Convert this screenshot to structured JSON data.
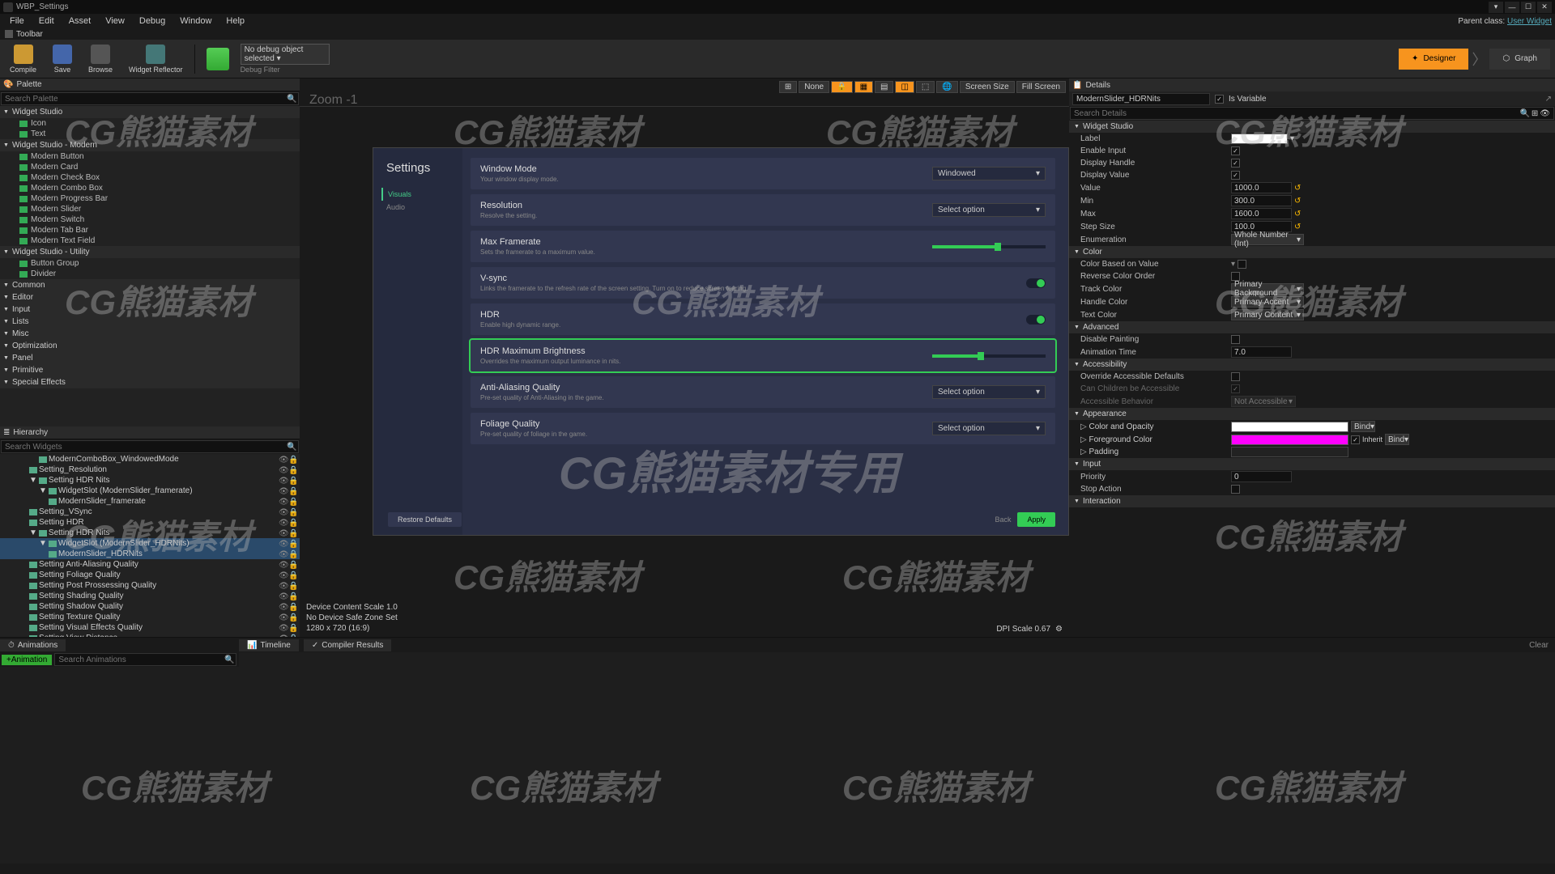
{
  "window": {
    "title": "WBP_Settings",
    "parent_class_label": "Parent class:",
    "parent_class": "User Widget"
  },
  "menubar": [
    "File",
    "Edit",
    "Asset",
    "View",
    "Debug",
    "Window",
    "Help"
  ],
  "toolbar": {
    "label": "Toolbar",
    "buttons": [
      "Compile",
      "Save",
      "Browse",
      "Widget Reflector"
    ],
    "debug_select": "No debug object selected",
    "debug_filter": "Debug Filter",
    "designer": "Designer",
    "graph": "Graph"
  },
  "palette": {
    "title": "Palette",
    "search_placeholder": "Search Palette",
    "categories": [
      {
        "name": "Widget Studio",
        "items": [
          "Icon",
          "Text"
        ]
      },
      {
        "name": "Widget Studio - Modern",
        "items": [
          "Modern Button",
          "Modern Card",
          "Modern Check Box",
          "Modern Combo Box",
          "Modern Progress Bar",
          "Modern Slider",
          "Modern Switch",
          "Modern Tab Bar",
          "Modern Text Field"
        ]
      },
      {
        "name": "Widget Studio - Utility",
        "items": [
          "Button Group",
          "Divider"
        ]
      },
      {
        "name": "Common",
        "items": []
      },
      {
        "name": "Editor",
        "items": []
      },
      {
        "name": "Input",
        "items": []
      },
      {
        "name": "Lists",
        "items": []
      },
      {
        "name": "Misc",
        "items": []
      },
      {
        "name": "Optimization",
        "items": []
      },
      {
        "name": "Panel",
        "items": []
      },
      {
        "name": "Primitive",
        "items": []
      },
      {
        "name": "Special Effects",
        "items": []
      }
    ]
  },
  "hierarchy": {
    "title": "Hierarchy",
    "search_placeholder": "Search Widgets",
    "items": [
      {
        "name": "ModernComboBox_WindowedMode",
        "indent": 4
      },
      {
        "name": "Setting_Resolution",
        "indent": 3
      },
      {
        "name": "Setting HDR Nits",
        "indent": 3,
        "expanded": true
      },
      {
        "name": "WidgetSlot (ModernSlider_framerate)",
        "indent": 4,
        "expanded": true
      },
      {
        "name": "ModernSlider_framerate",
        "indent": 5
      },
      {
        "name": "Setting_VSync",
        "indent": 3
      },
      {
        "name": "Setting HDR",
        "indent": 3
      },
      {
        "name": "Setting HDR Nits",
        "indent": 3,
        "expanded": true
      },
      {
        "name": "WidgetSlot (ModernSlider_HDRNits)",
        "indent": 4,
        "selected": true,
        "expanded": true
      },
      {
        "name": "ModernSlider_HDRNits",
        "indent": 5,
        "selected": true
      },
      {
        "name": "Setting Anti-Aliasing Quality",
        "indent": 3
      },
      {
        "name": "Setting Foliage Quality",
        "indent": 3
      },
      {
        "name": "Setting Post Prossessing Quality",
        "indent": 3
      },
      {
        "name": "Setting Shading Quality",
        "indent": 3
      },
      {
        "name": "Setting Shadow Quality",
        "indent": 3
      },
      {
        "name": "Setting Texture Quality",
        "indent": 3
      },
      {
        "name": "Setting Visual Effects Quality",
        "indent": 3
      },
      {
        "name": "Setting View Distance",
        "indent": 3
      }
    ]
  },
  "viewport": {
    "zoom": "Zoom -1",
    "none_btn": "None",
    "screen_size": "Screen Size",
    "fill_screen": "Fill Screen",
    "status_scale": "Device Content Scale 1.0",
    "status_safezone": "No Device Safe Zone Set",
    "status_res": "1280 x 720 (16:9)",
    "dpi": "DPI Scale 0.67"
  },
  "preview": {
    "title": "Settings",
    "nav": [
      {
        "label": "Visuals",
        "active": true
      },
      {
        "label": "Audio",
        "active": false
      }
    ],
    "rows": [
      {
        "label": "Window Mode",
        "desc": "Your window display mode.",
        "type": "select",
        "value": "Windowed"
      },
      {
        "label": "Resolution",
        "desc": "Resolve the setting.",
        "type": "select",
        "value": "Select option"
      },
      {
        "label": "Max Framerate",
        "desc": "Sets the framerate to a maximum value.",
        "type": "slider",
        "pct": 55
      },
      {
        "label": "V-sync",
        "desc": "Links the framerate to the refresh rate of the screen setting. Turn on to reduce screen tearing.",
        "type": "toggle",
        "on": true
      },
      {
        "label": "HDR",
        "desc": "Enable high dynamic range.",
        "type": "toggle",
        "on": true
      },
      {
        "label": "HDR Maximum Brightness",
        "desc": "Overrides the maximum output luminance in nits.",
        "type": "slider",
        "pct": 40,
        "selected": true
      },
      {
        "label": "Anti-Aliasing Quality",
        "desc": "Pre-set quality of Anti-Aliasing in the game.",
        "type": "select",
        "value": "Select option"
      },
      {
        "label": "Foliage Quality",
        "desc": "Pre-set quality of foliage in the game.",
        "type": "select",
        "value": "Select option"
      }
    ],
    "restore_btn": "Restore Defaults",
    "back_btn": "Back",
    "apply_btn": "Apply"
  },
  "details": {
    "title": "Details",
    "name": "ModernSlider_HDRNits",
    "is_variable": "Is Variable",
    "search_placeholder": "Search Details",
    "sections": {
      "widget_studio": {
        "title": "Widget Studio",
        "label": "Label",
        "enable_input": "Enable Input",
        "display_handle": "Display Handle",
        "display_value": "Display Value",
        "value": "Value",
        "value_v": "1000.0",
        "min": "Min",
        "min_v": "300.0",
        "max": "Max",
        "max_v": "1600.0",
        "step_size": "Step Size",
        "step_v": "100.0",
        "enumeration": "Enumeration",
        "enum_v": "Whole Number (Int)"
      },
      "color": {
        "title": "Color",
        "color_based": "Color Based on Value",
        "reverse": "Reverse Color Order",
        "track": "Track Color",
        "track_v": "Primary Background",
        "handle": "Handle Color",
        "handle_v": "Primary Accent",
        "text": "Text Color",
        "text_v": "Primary Content"
      },
      "advanced": {
        "title": "Advanced",
        "disable_painting": "Disable Painting",
        "anim_time": "Animation Time",
        "anim_v": "7.0"
      },
      "accessibility": {
        "title": "Accessibility",
        "override": "Override Accessible Defaults",
        "children": "Can Children be Accessible",
        "behavior": "Accessible Behavior",
        "behavior_v": "Not Accessible"
      },
      "appearance": {
        "title": "Appearance",
        "color_opacity": "Color and Opacity",
        "fg_color": "Foreground Color",
        "inherit": "Inherit",
        "padding": "Padding",
        "bind": "Bind"
      },
      "input": {
        "title": "Input",
        "priority": "Priority",
        "priority_v": "0",
        "stop_action": "Stop Action"
      },
      "interaction": {
        "title": "Interaction"
      }
    }
  },
  "bottom": {
    "animations": "Animations",
    "timeline": "Timeline",
    "compiler": "Compiler Results",
    "add_anim": "+Animation",
    "search_anim": "Search Animations",
    "clear": "Clear"
  },
  "watermark": "CG熊猫素材"
}
